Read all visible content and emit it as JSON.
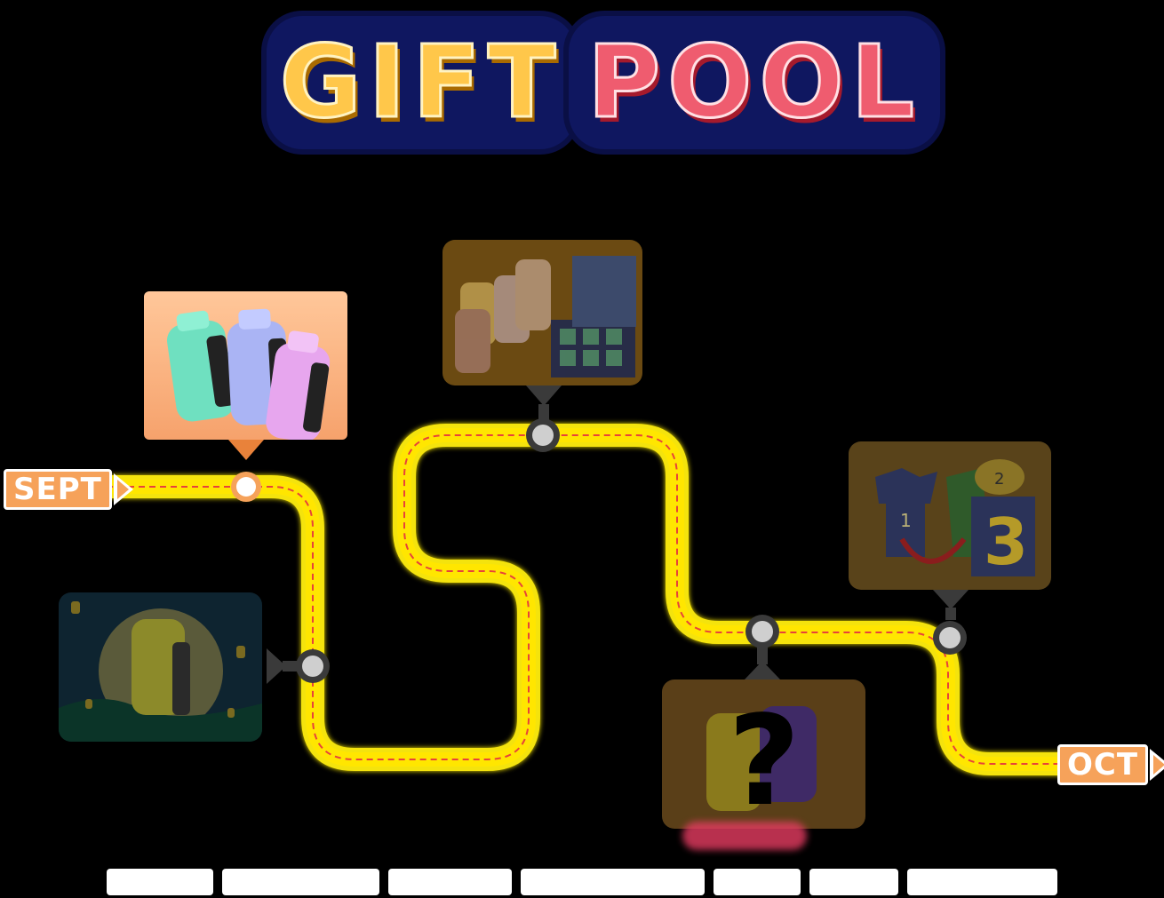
{
  "title": {
    "word1": "GIFT",
    "word2": "POOL"
  },
  "timeline": {
    "start_label": "SEPT",
    "end_label": "OCT"
  },
  "milestones": [
    {
      "name": "vape-trio-pastel",
      "state": "active"
    },
    {
      "name": "gift-box-set",
      "state": "locked"
    },
    {
      "name": "moon-festival-vape",
      "state": "locked"
    },
    {
      "name": "mystery-vape",
      "state": "locked",
      "mark": "?"
    },
    {
      "name": "apparel-bundle",
      "state": "locked",
      "labels": [
        "1",
        "2",
        "3"
      ]
    }
  ],
  "colors": {
    "road": "#f4e30a",
    "road_dash": "#e7423a",
    "active_node": "#f6a25a",
    "locked_node": "#3a3a3a",
    "tag": "#f6a25a"
  },
  "footer": {
    "text": ""
  }
}
